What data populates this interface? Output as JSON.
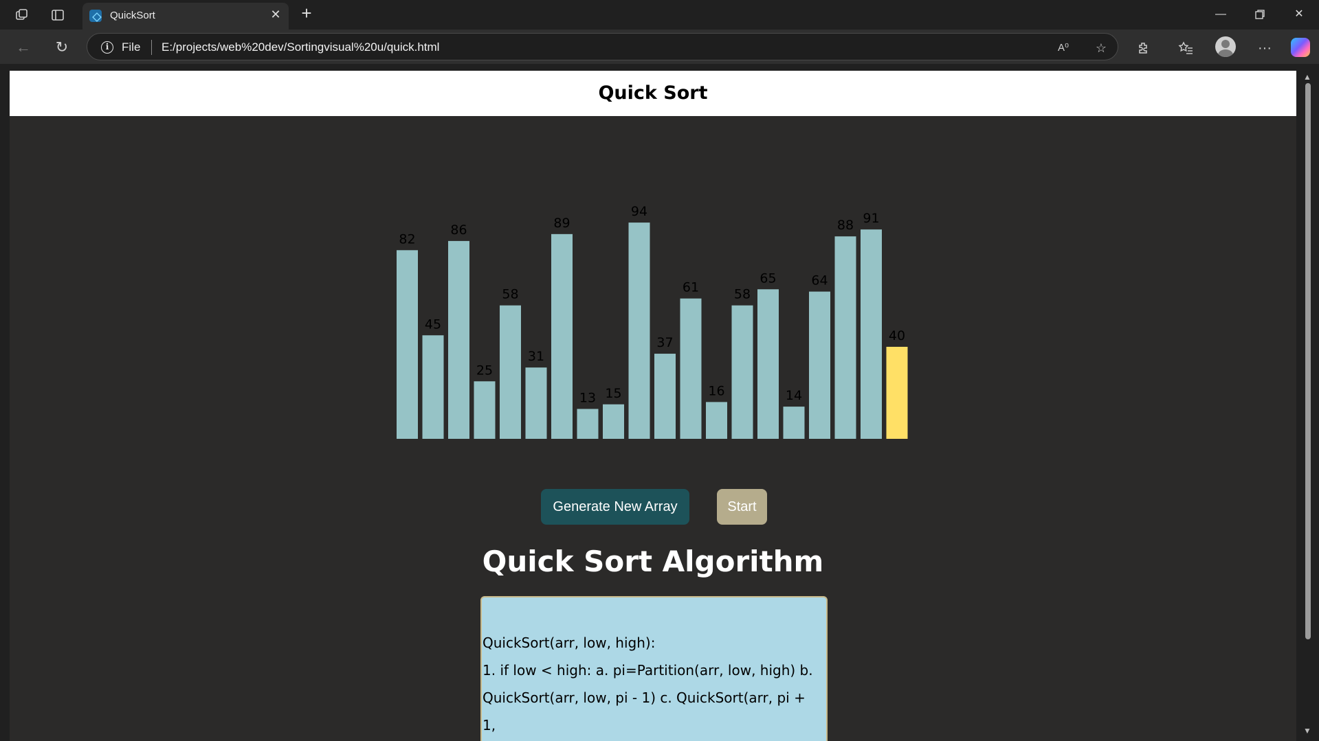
{
  "browser": {
    "tab_title": "QuickSort",
    "url_scheme": "File",
    "url": "E:/projects/web%20dev/Sortingvisual%20u/quick.html"
  },
  "page": {
    "header_title": "Quick Sort",
    "generate_button": "Generate New Array",
    "start_button": "Start",
    "algorithm_title": "Quick Sort Algorithm",
    "code_lines": [
      "QuickSort(arr, low, high):",
      "1. if low < high: a. pi=Partition(arr, low, high) b.",
      "QuickSort(arr, low, pi - 1) c. QuickSort(arr, pi +",
      "1,"
    ]
  },
  "colors": {
    "bar": "#96c3c6",
    "pivot_bar": "#ffe066",
    "generate_button": "#1d5259",
    "start_button": "#b5ac8c",
    "code_box": "#add8e6"
  },
  "chart_data": {
    "type": "bar",
    "values": [
      82,
      45,
      86,
      25,
      58,
      31,
      89,
      13,
      15,
      94,
      37,
      61,
      16,
      58,
      65,
      14,
      64,
      88,
      91,
      40
    ],
    "highlighted_index": 19
  }
}
